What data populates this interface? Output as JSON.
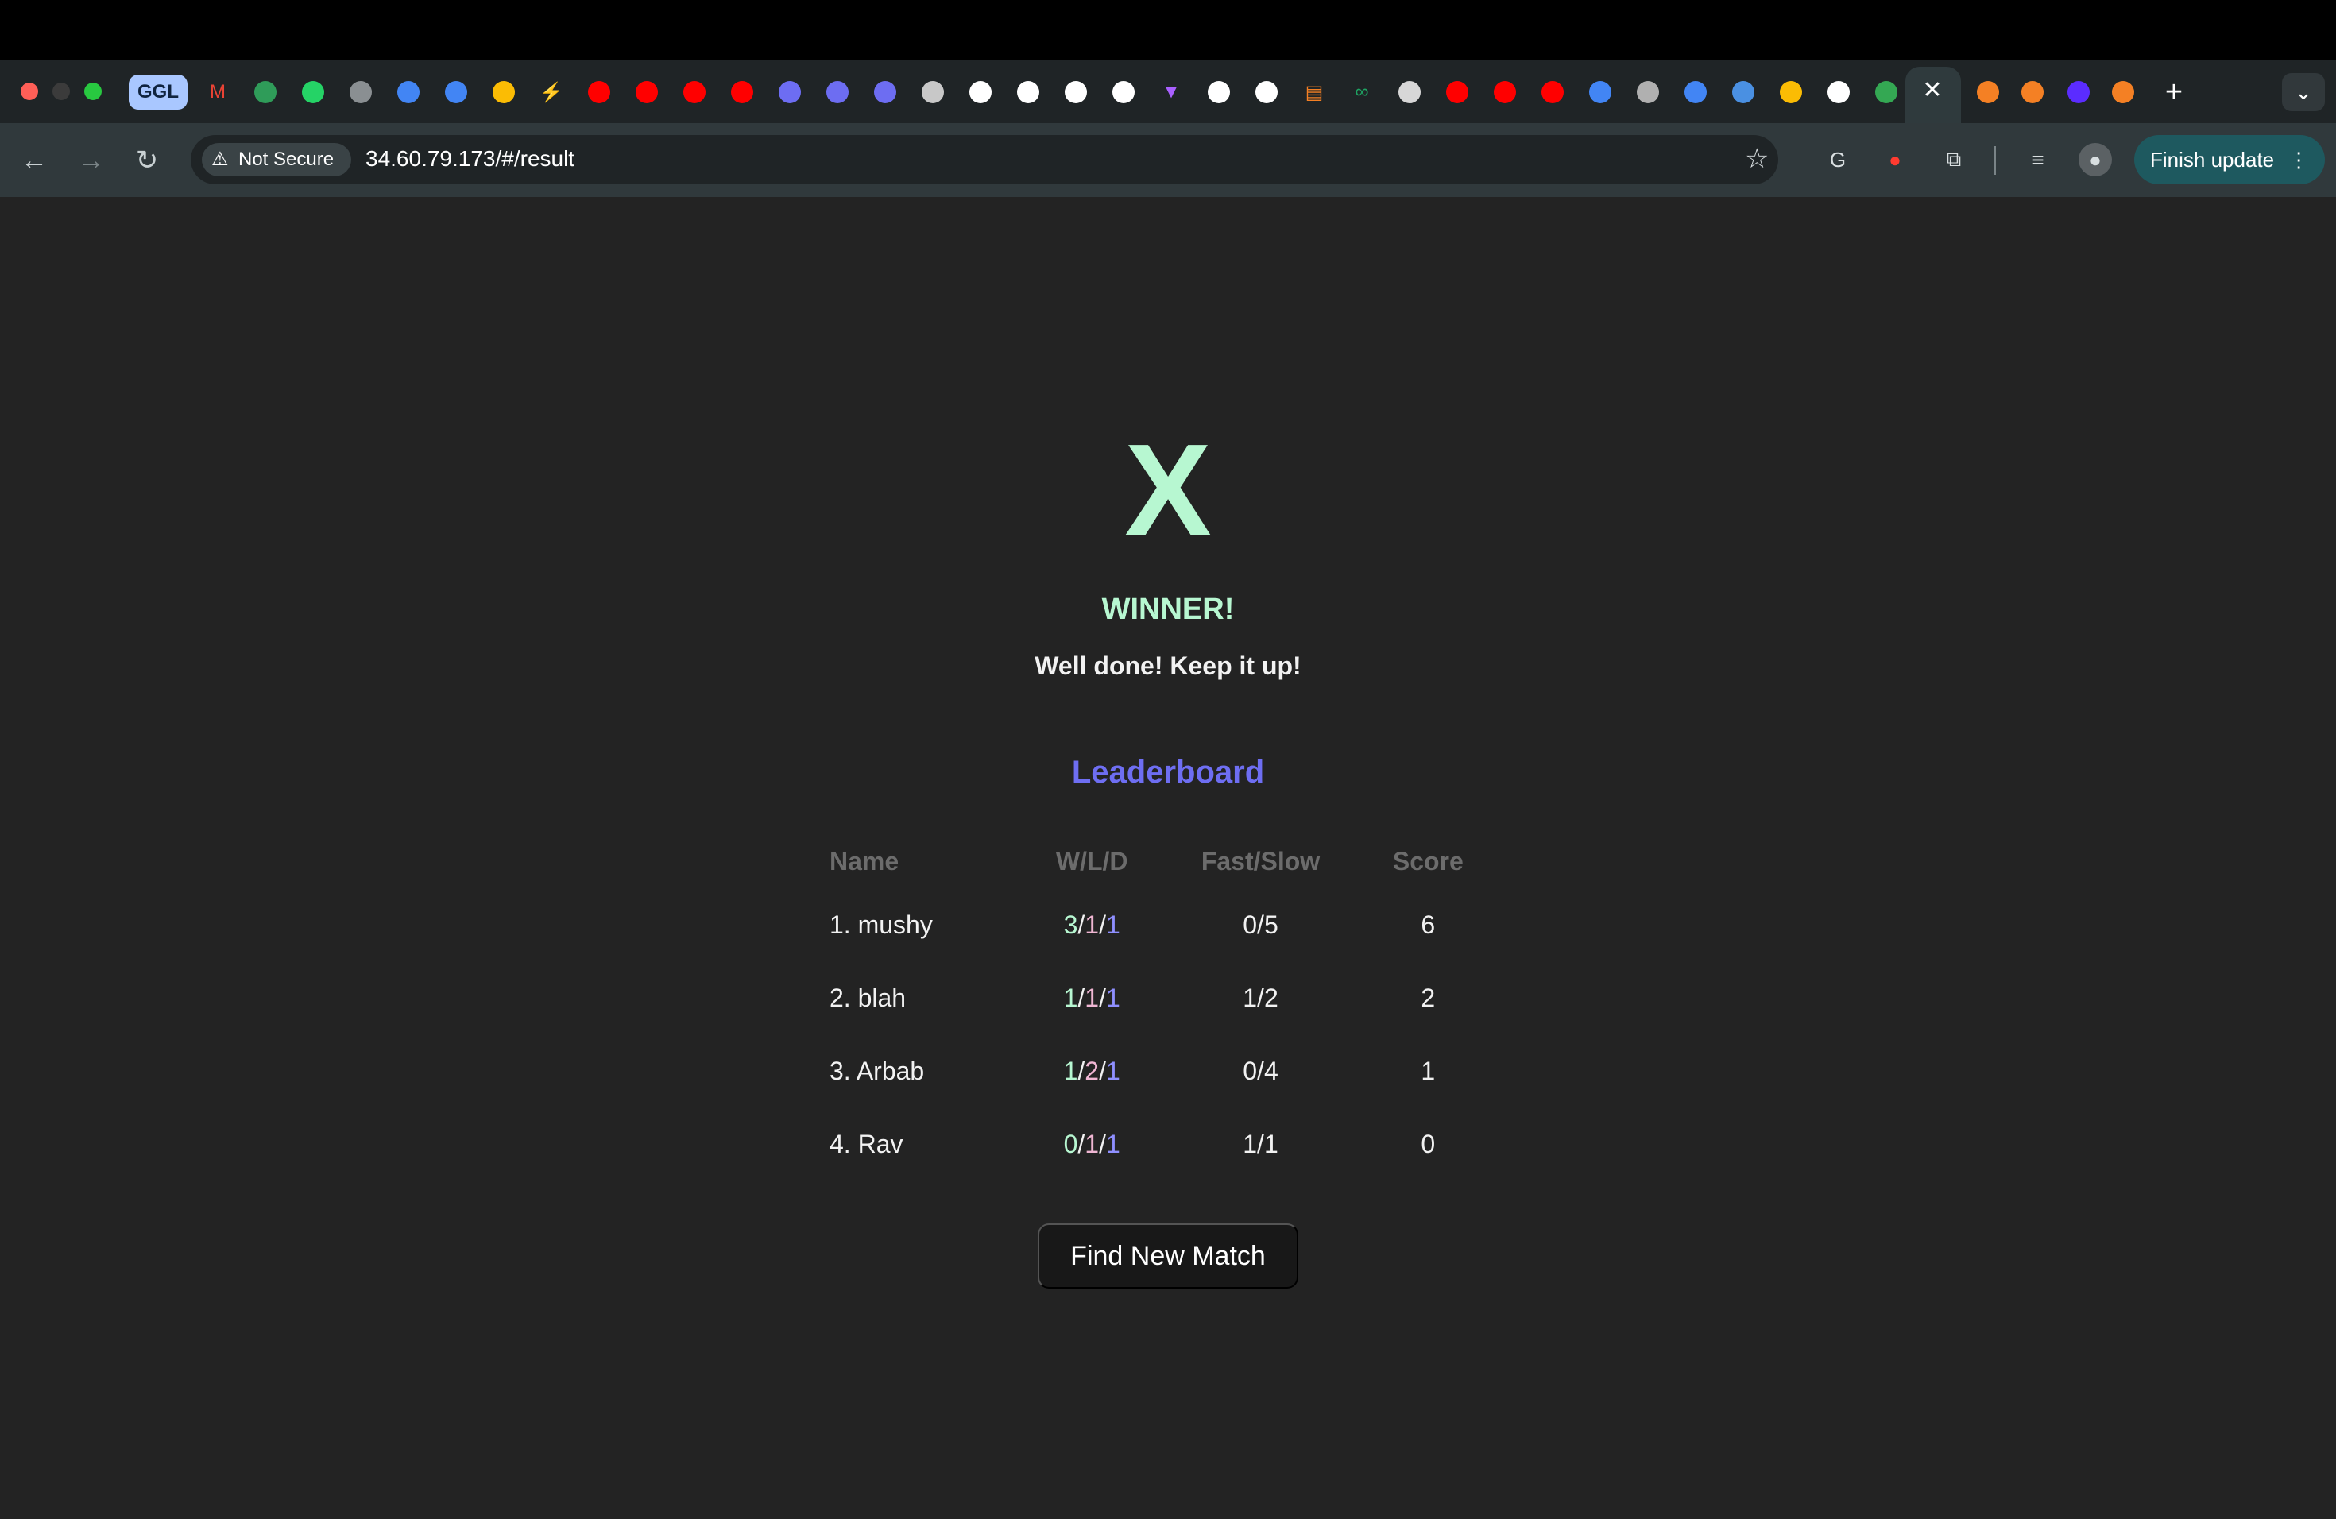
{
  "browser": {
    "tabs": [
      "GGL"
    ],
    "active_tab_close": "✕",
    "new_tab": "+",
    "not_secure": "Not Secure",
    "url": "34.60.79.173/#/result",
    "update_button": "Finish update",
    "menu_dots": "⋮"
  },
  "result": {
    "symbol": "X",
    "title": "WINNER!",
    "subtitle": "Well done! Keep it up!"
  },
  "leaderboard": {
    "title": "Leaderboard",
    "headers": [
      "Name",
      "W/L/D",
      "Fast/Slow",
      "Score"
    ],
    "rows": [
      {
        "name": "1. mushy",
        "wins": "3",
        "losses": "1",
        "draws": "1",
        "fast_slow": "0/5",
        "score": "6"
      },
      {
        "name": "2. blah",
        "wins": "1",
        "losses": "1",
        "draws": "1",
        "fast_slow": "1/2",
        "score": "2"
      },
      {
        "name": "3. Arbab",
        "wins": "1",
        "losses": "2",
        "draws": "1",
        "fast_slow": "0/4",
        "score": "1"
      },
      {
        "name": "4. Rav",
        "wins": "0",
        "losses": "1",
        "draws": "1",
        "fast_slow": "1/1",
        "score": "0"
      }
    ]
  },
  "actions": {
    "find_new_match": "Find New Match"
  },
  "colors": {
    "accent_green": "#b7f7d1",
    "accent_purple": "#6e6ef2",
    "background": "#232323"
  }
}
